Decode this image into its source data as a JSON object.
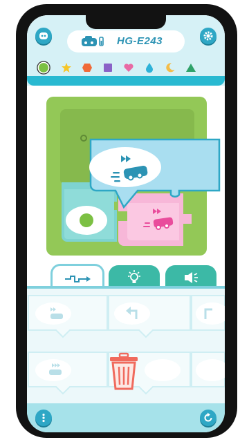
{
  "device": {
    "name": "HG-E243"
  },
  "filters": [
    {
      "icon": "green-circle-icon",
      "color": "#7cc043",
      "selected": true
    },
    {
      "icon": "star-icon",
      "color": "#f6c628"
    },
    {
      "icon": "hexagon-icon",
      "color": "#f06a38"
    },
    {
      "icon": "square-icon",
      "color": "#8a62c7"
    },
    {
      "icon": "heart-icon",
      "color": "#e86aa4"
    },
    {
      "icon": "drop-icon",
      "color": "#2eb2d8"
    },
    {
      "icon": "moon-icon",
      "color": "#f4bd49"
    },
    {
      "icon": "triangle-icon",
      "color": "#2fa26a"
    }
  ],
  "tabs": [
    {
      "name": "flow-tab",
      "icon": "flow-line-icon",
      "active": true
    },
    {
      "name": "light-tab",
      "icon": "lightbulb-icon",
      "active": false
    },
    {
      "name": "sound-tab",
      "icon": "speaker-icon",
      "active": false
    }
  ],
  "colors": {
    "header_bg": "#d6f1f6",
    "accent": "#29b9d1",
    "board_green": "#93c857",
    "start_block": "#7ed3d0",
    "pink_block": "#f7b7d8",
    "move_block": "#a9def0"
  }
}
